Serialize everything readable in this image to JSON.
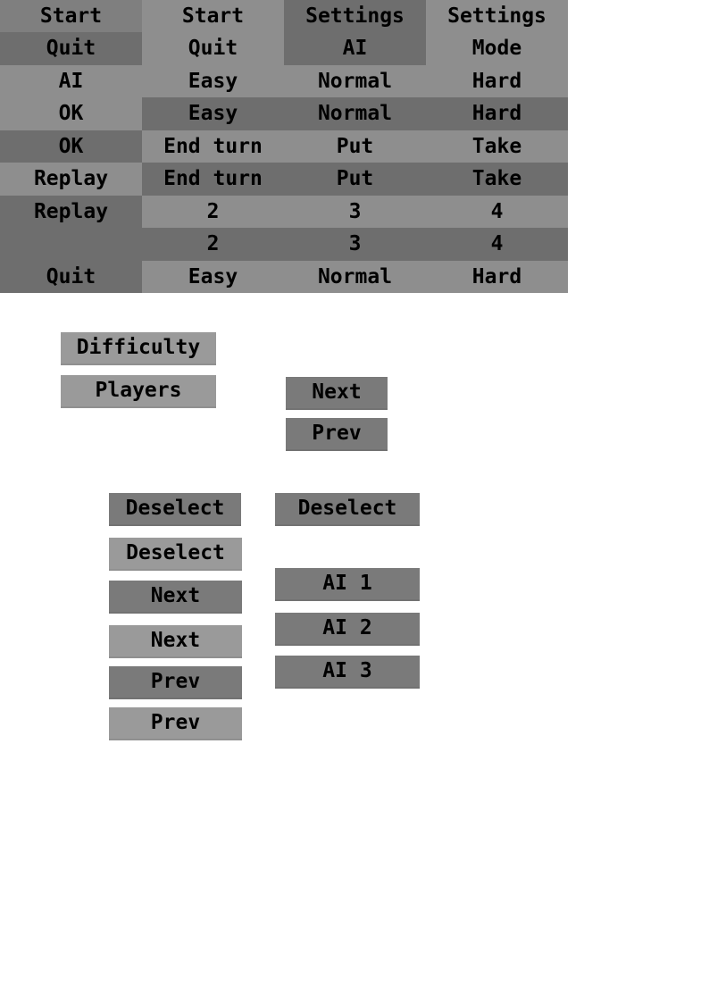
{
  "colors": {
    "dark": "#6e6e6e",
    "medium": "#7f7f7f",
    "light": "#8e8e8e",
    "button_dark": "#7a7a7a",
    "button_light": "#9a9a9a"
  },
  "sheet": {
    "rows": [
      [
        "Start",
        "Start",
        "Settings",
        "Settings"
      ],
      [
        "Quit",
        "Quit",
        "AI",
        "Mode"
      ],
      [
        "AI",
        "Easy",
        "Normal",
        "Hard"
      ],
      [
        "OK",
        "Easy",
        "Normal",
        "Hard"
      ],
      [
        "OK",
        "End turn",
        "Put",
        "Take"
      ],
      [
        "Replay",
        "End turn",
        "Put",
        "Take"
      ],
      [
        "Replay",
        "2",
        "3",
        "4"
      ],
      [
        "",
        "2",
        "3",
        "4"
      ],
      [
        "Quit",
        "Easy",
        "Normal",
        "Hard"
      ]
    ],
    "shades": [
      [
        "medium",
        "light",
        "dark",
        "light"
      ],
      [
        "dark",
        "light",
        "dark",
        "light"
      ],
      [
        "light",
        "light",
        "light",
        "light"
      ],
      [
        "light",
        "dark",
        "dark",
        "dark"
      ],
      [
        "dark",
        "light",
        "light",
        "light"
      ],
      [
        "light",
        "dark",
        "dark",
        "dark"
      ],
      [
        "dark",
        "light",
        "light",
        "light"
      ],
      [
        "dark",
        "dark",
        "dark",
        "dark"
      ],
      [
        "dark",
        "light",
        "light",
        "light"
      ]
    ]
  },
  "settings_buttons": {
    "difficulty": "Difficulty",
    "players": "Players"
  },
  "pager_buttons": {
    "next": "Next",
    "prev": "Prev"
  },
  "state_buttons": {
    "deselect_dark": "Deselect",
    "deselect_light": "Deselect",
    "next_dark": "Next",
    "next_light": "Next",
    "prev_dark": "Prev",
    "prev_light": "Prev"
  },
  "ai_buttons": {
    "deselect": "Deselect",
    "ai1": "AI 1",
    "ai2": "AI 2",
    "ai3": "AI 3"
  }
}
